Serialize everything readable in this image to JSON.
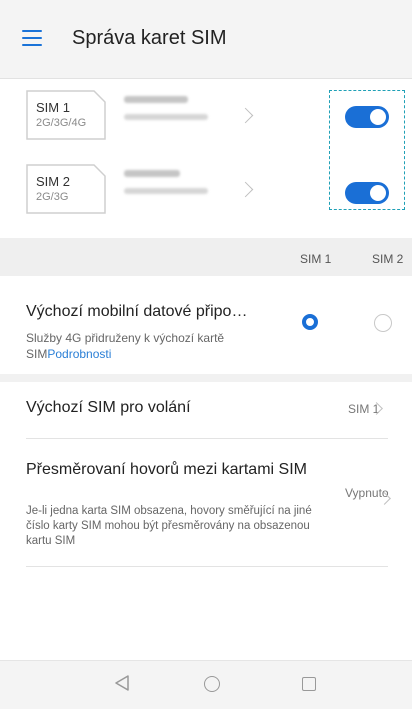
{
  "header": {
    "title": "Správa karet SIM",
    "menu_icon": "hamburger-menu-icon"
  },
  "sims": [
    {
      "name": "SIM 1",
      "bands": "2G/3G/4G",
      "enabled": true
    },
    {
      "name": "SIM 2",
      "bands": "2G/3G",
      "enabled": true
    }
  ],
  "columns": {
    "sim1": "SIM 1",
    "sim2": "SIM 2"
  },
  "mobile_data": {
    "title": "Výchozí mobilní datové připo…",
    "subtitle": "Služby 4G přidruženy k výchozí kartě SIM",
    "link": "Podrobnosti",
    "selected": "SIM 1"
  },
  "calls": {
    "title": "Výchozí SIM pro volání",
    "value": "SIM 1"
  },
  "forwarding": {
    "title": "Přesměrovaní hovorů mezi kartami SIM",
    "description": "Je-li jedna karta SIM obsazena, hovory směřující na jiné číslo karty SIM mohou být přesměrovány na obsazenou kartu SIM",
    "value": "Vypnuto"
  },
  "colors": {
    "accent": "#1a6fd6",
    "link": "#2a7fd6",
    "highlight_dashed": "#1fa0b6"
  },
  "nav_icons": [
    "back-icon",
    "home-icon",
    "recent-apps-icon"
  ]
}
